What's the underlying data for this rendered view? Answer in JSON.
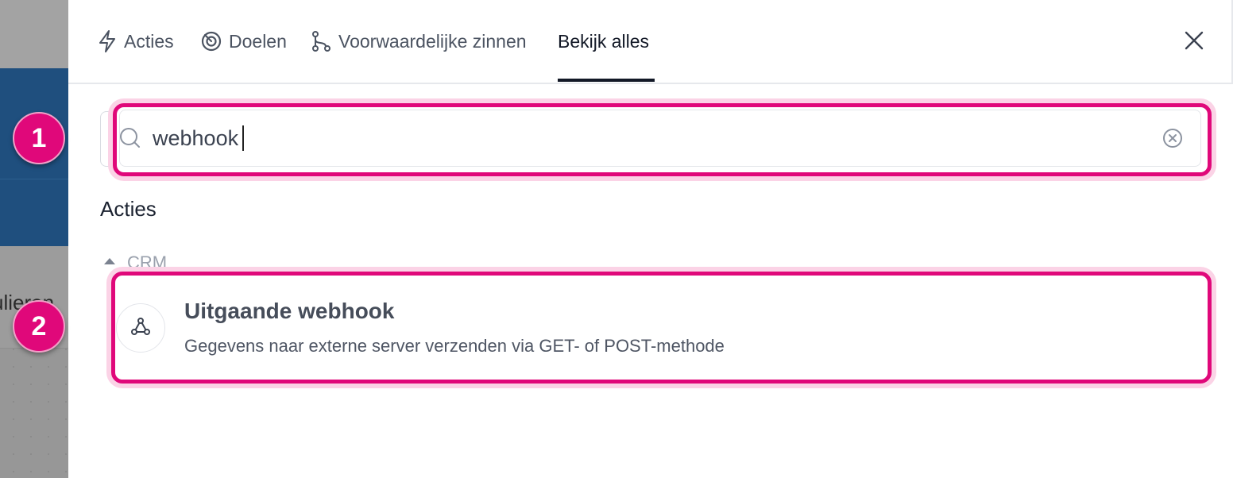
{
  "background": {
    "partial_text": "ulieren"
  },
  "tabs": [
    {
      "label": "Acties",
      "icon": "bolt-icon"
    },
    {
      "label": "Doelen",
      "icon": "target-icon"
    },
    {
      "label": "Voorwaardelijke zinnen",
      "icon": "branch-icon"
    },
    {
      "label": "Bekijk alles",
      "active": true
    }
  ],
  "search": {
    "value": "webhook"
  },
  "results": {
    "section_title": "Acties",
    "group_label": "CRM",
    "items": [
      {
        "title": "Uitgaande webhook",
        "description": "Gegevens naar externe server verzenden via GET- of POST-methode",
        "icon": "webhook-icon"
      }
    ]
  },
  "annotations": {
    "step1": "1",
    "step2": "2"
  },
  "colors": {
    "highlight": "#e0087a",
    "active_tab": "#121826",
    "background_blue": "#1f4f7e"
  }
}
